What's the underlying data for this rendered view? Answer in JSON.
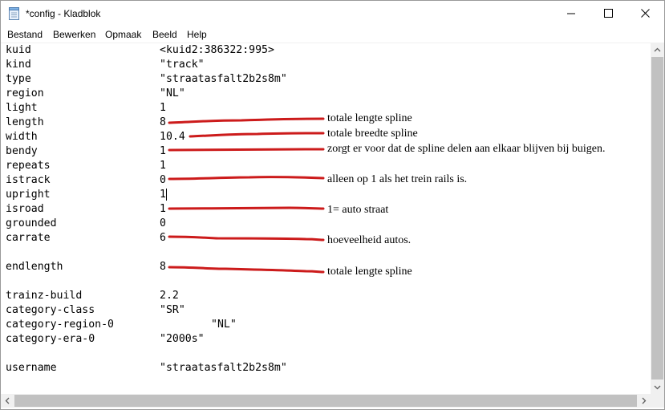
{
  "window": {
    "title": "*config - Kladblok",
    "icons": {
      "app": "notepad-icon",
      "minimize": "minimize-icon",
      "maximize": "maximize-icon",
      "close": "close-icon"
    }
  },
  "menu": [
    {
      "id": "bestand",
      "label": "Bestand"
    },
    {
      "id": "bewerken",
      "label": "Bewerken"
    },
    {
      "id": "opmaak",
      "label": "Opmaak"
    },
    {
      "id": "beeld",
      "label": "Beeld"
    },
    {
      "id": "help",
      "label": "Help"
    }
  ],
  "lines": [
    {
      "key": "kuid",
      "value": "<kuid2:386322:995>"
    },
    {
      "key": "kind",
      "value": "\"track\""
    },
    {
      "key": "type",
      "value": "\"straatasfalt2b2s8m\""
    },
    {
      "key": "region",
      "value": "\"NL\""
    },
    {
      "key": "light",
      "value": "1"
    },
    {
      "key": "length",
      "value": "8"
    },
    {
      "key": "width",
      "value": "10.4"
    },
    {
      "key": "bendy",
      "value": "1"
    },
    {
      "key": "repeats",
      "value": "1"
    },
    {
      "key": "istrack",
      "value": "0"
    },
    {
      "key": "upright",
      "value": "1"
    },
    {
      "key": "isroad",
      "value": "1"
    },
    {
      "key": "grounded",
      "value": "0"
    },
    {
      "key": "carrate",
      "value": "6"
    },
    {
      "key": "",
      "value": ""
    },
    {
      "key": "endlength",
      "value": "8"
    },
    {
      "key": "",
      "value": ""
    },
    {
      "key": "trainz-build",
      "value": "2.2"
    },
    {
      "key": "category-class",
      "value": "\"SR\""
    },
    {
      "key": "category-region-0",
      "value": "\"NL\""
    },
    {
      "key": "category-era-0",
      "value": "\"2000s\""
    },
    {
      "key": "",
      "value": ""
    },
    {
      "key": "username",
      "value": "\"straatasfalt2b2s8m\""
    }
  ],
  "annotations": [
    {
      "id": "length",
      "text": "totale lengte spline"
    },
    {
      "id": "width",
      "text": "totale breedte spline"
    },
    {
      "id": "bendy",
      "text": "zorgt er voor dat de spline delen aan elkaar blijven bij buigen."
    },
    {
      "id": "istrack",
      "text": "alleen op 1 als het trein rails is."
    },
    {
      "id": "isroad",
      "text": "1= auto straat"
    },
    {
      "id": "carrate",
      "text": "hoeveelheid autos."
    },
    {
      "id": "endlength",
      "text": "totale lengte spline"
    }
  ],
  "colors": {
    "annotation_stroke": "#cc1b1b",
    "scrollbar_track": "#f0f0f0",
    "scrollbar_thumb": "#c1c1c1",
    "text": "#000000"
  }
}
